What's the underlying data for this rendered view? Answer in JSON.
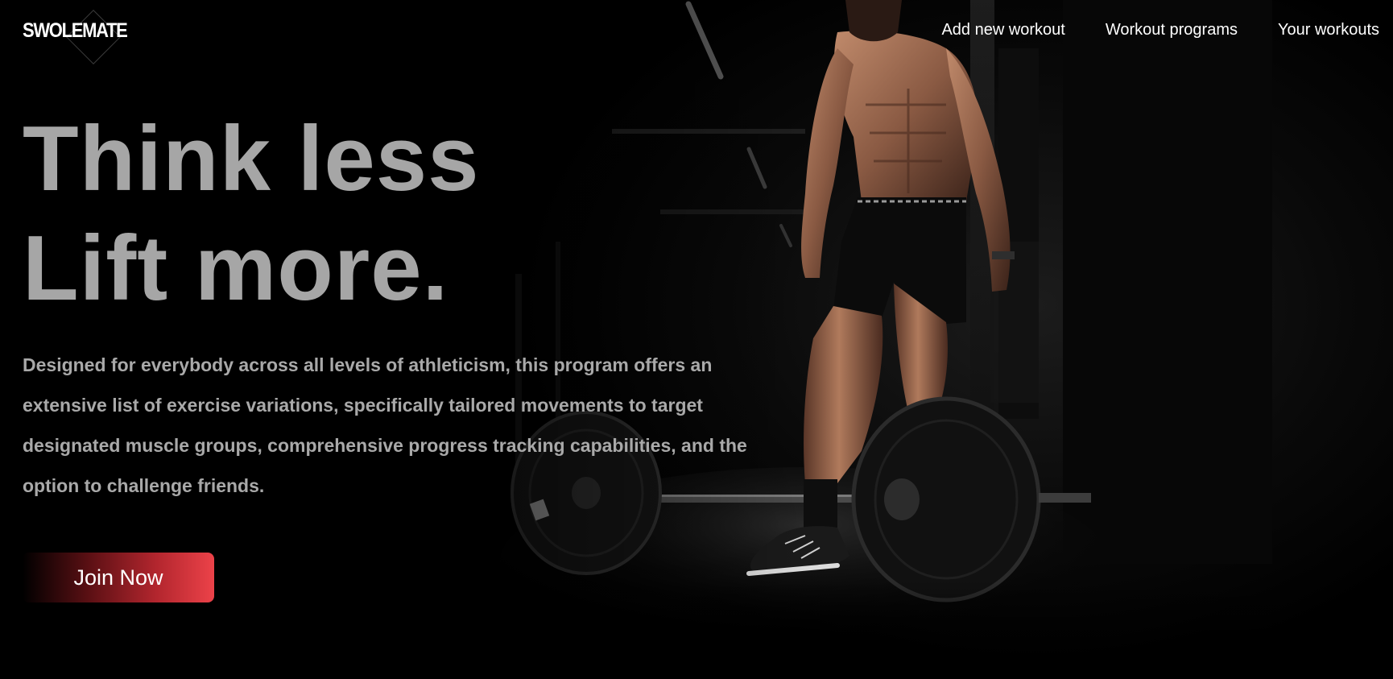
{
  "brand": {
    "logo_text": "SWOLEMATE"
  },
  "nav": {
    "items": [
      {
        "label": "Add new workout"
      },
      {
        "label": "Workout programs"
      },
      {
        "label": "Your workouts"
      }
    ]
  },
  "hero": {
    "headline_line1": "Think less",
    "headline_line2": "Lift more.",
    "description": "Designed for everybody across all levels of athleticism, this program offers an extensive list of exercise variations, specifically tailored movements to target designated muscle groups, comprehensive progress tracking capabilities, and the option to challenge friends.",
    "cta_label": "Join Now"
  },
  "colors": {
    "background": "#000000",
    "headline": "#a6a6a6",
    "body_text": "#a9a9a9",
    "nav_text": "#ffffff",
    "cta_gradient_end": "#ec4249"
  }
}
